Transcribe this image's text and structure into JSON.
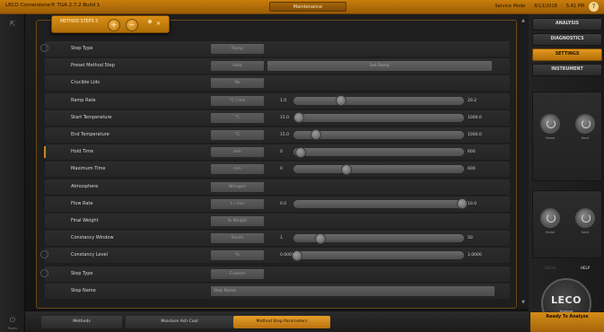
{
  "window": {
    "title": "LECO Cornerstone® TGA 2.7.2 Build 1",
    "center_label": "Maintenance",
    "mode": "Service Mode",
    "date": "8/13/2018",
    "time": "5:41 PM",
    "help_label": "?"
  },
  "left_rail": {
    "top_label": "",
    "bottom_label": "Power"
  },
  "popup": {
    "title": "METHOD STEPS",
    "count": "3",
    "add_symbol": "+",
    "remove_symbol": "−",
    "close_symbol": "✕"
  },
  "steps": [
    {
      "label": "Step Type",
      "unit": "Ramp"
    },
    {
      "label": "Preset Method Step",
      "unit": "Hold",
      "wide": "Set Ramp"
    },
    {
      "label": "Crucible Lids",
      "unit": "No"
    },
    {
      "label": "Ramp Rate",
      "unit": "°C / min",
      "min": "1.0",
      "max": "20.2",
      "fraction": 0.28
    },
    {
      "label": "Start Temperature",
      "unit": "°C",
      "min": "15.0",
      "max": "1000.0",
      "fraction": 0.03
    },
    {
      "label": "End Temperature",
      "unit": "°C",
      "min": "15.0",
      "max": "1000.0",
      "fraction": 0.13
    },
    {
      "label": "Hold Time",
      "unit": "min",
      "min": "0",
      "max": "600",
      "fraction": 0.04
    },
    {
      "label": "Maximum Time",
      "unit": "min",
      "min": "0",
      "max": "600",
      "fraction": 0.31
    },
    {
      "label": "Atmosphere",
      "unit": "Nitrogen"
    },
    {
      "label": "Flow Rate",
      "unit": "L / min",
      "min": "0.0",
      "max": "10.0",
      "fraction": 0.99
    },
    {
      "label": "Final Weight",
      "unit": "% Weight"
    },
    {
      "label": "Constancy Window",
      "unit": "Points",
      "min": "1",
      "max": "50",
      "fraction": 0.16
    },
    {
      "label": "Constancy Level",
      "unit": "%",
      "min": "0.0000",
      "max": "1.0000",
      "fraction": 0.02
    },
    {
      "label": "Step Type",
      "unit": "Custom"
    },
    {
      "label": "Step Name",
      "text": "Step Name"
    }
  ],
  "right_panel": {
    "nav": [
      "ANALYSIS",
      "DIAGNOSTICS",
      "SETTINGS",
      "INSTRUMENT"
    ],
    "active": "SETTINGS",
    "knobs": [
      "Home",
      "Next",
      "Home",
      "Next"
    ],
    "toggle_left": "LOCAL",
    "toggle_right": "HELP",
    "logo_text": "LECO",
    "logo_sub": "Analyze",
    "status": "Ready To Analyze"
  },
  "breadcrumbs": [
    "Methods",
    "Moisture Ash Coal",
    "Method Step Parameters"
  ]
}
